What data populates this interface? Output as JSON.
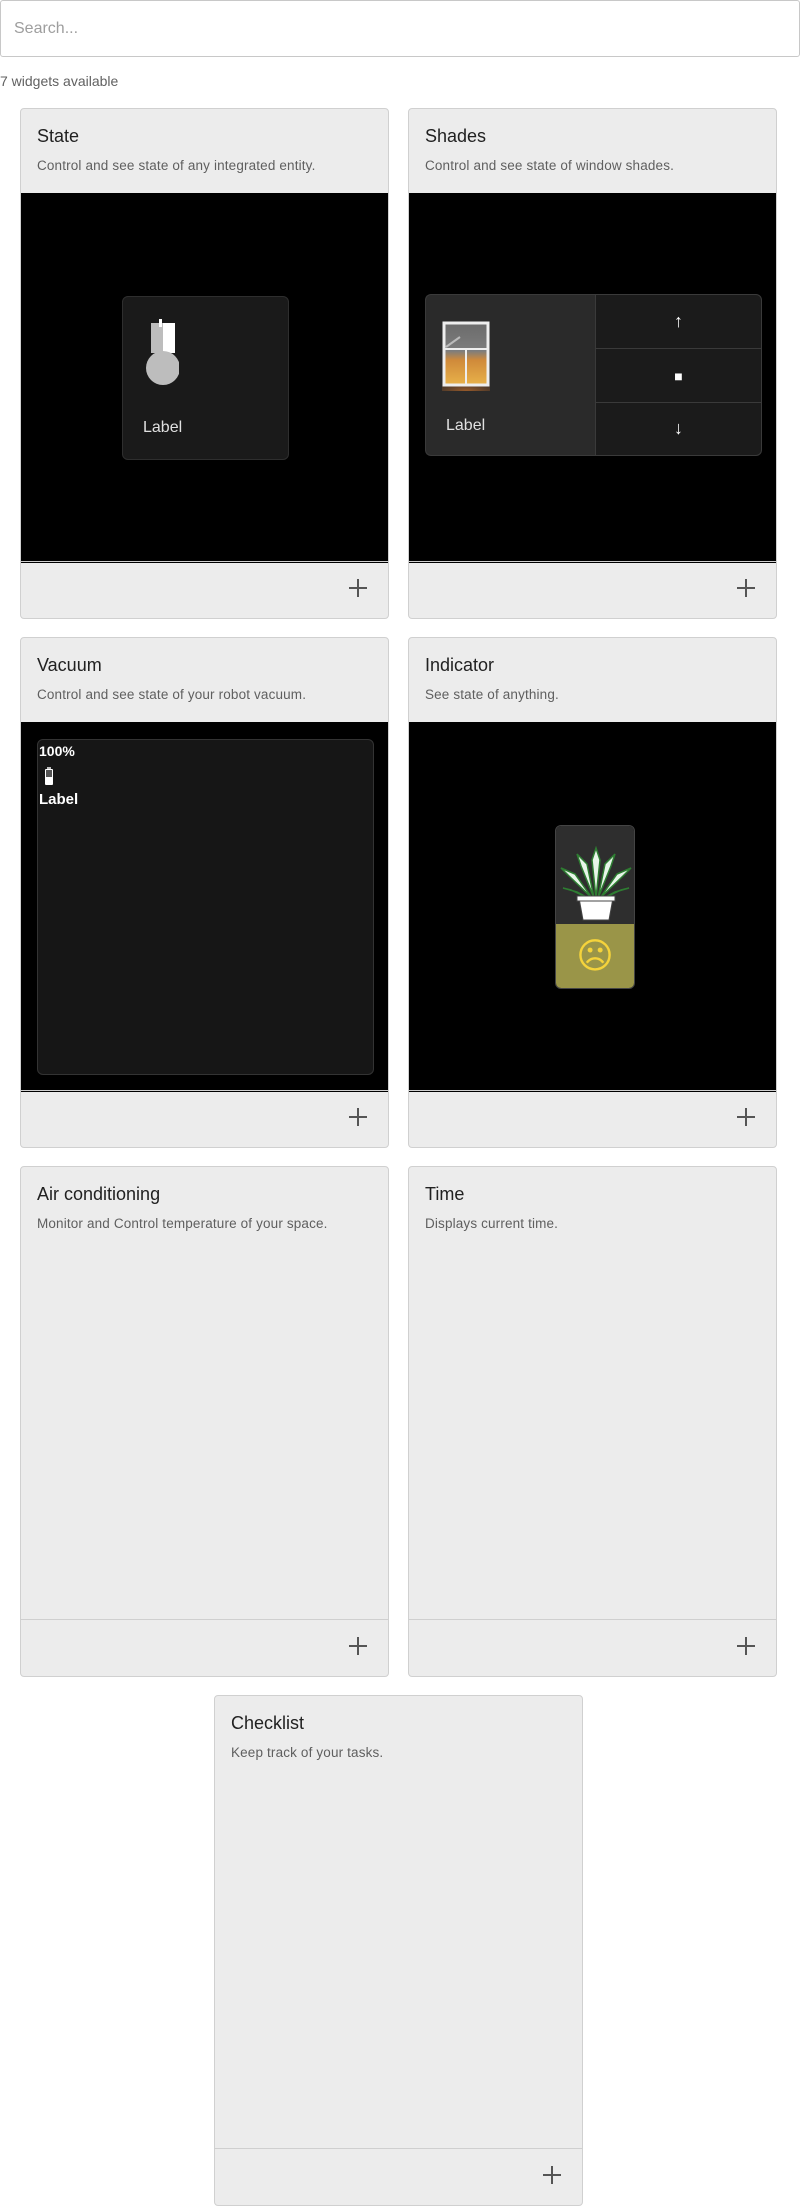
{
  "search": {
    "placeholder": "Search...",
    "value": ""
  },
  "count_label": "7 widgets available",
  "cards": [
    {
      "title": "State",
      "description": "Control and see state of any integrated entity.",
      "preview": {
        "label": "Label",
        "icon": "bulb-icon"
      }
    },
    {
      "title": "Shades",
      "description": "Control and see state of window shades.",
      "preview": {
        "label": "Label",
        "icon": "window-icon",
        "up": "↑",
        "stop": "■",
        "down": "↓"
      }
    },
    {
      "title": "Vacuum",
      "description": "Control and see state of your robot vacuum.",
      "preview": {
        "battery": "100%",
        "label": "Label",
        "icon": "battery-icon"
      }
    },
    {
      "title": "Indicator",
      "description": "See state of anything.",
      "preview": {
        "icon": "plant-icon",
        "face": "☹",
        "status_color": "#9a9548"
      }
    },
    {
      "title": "Air conditioning",
      "description": "Monitor and Control temperature of your space."
    },
    {
      "title": "Time",
      "description": "Displays current time."
    },
    {
      "title": "Checklist",
      "description": "Keep track of your tasks."
    }
  ],
  "colors": {
    "card_bg": "#ececec",
    "preview_bg": "#000000",
    "indicator_status": "#9a9548",
    "indicator_face": "#f5d33b"
  }
}
